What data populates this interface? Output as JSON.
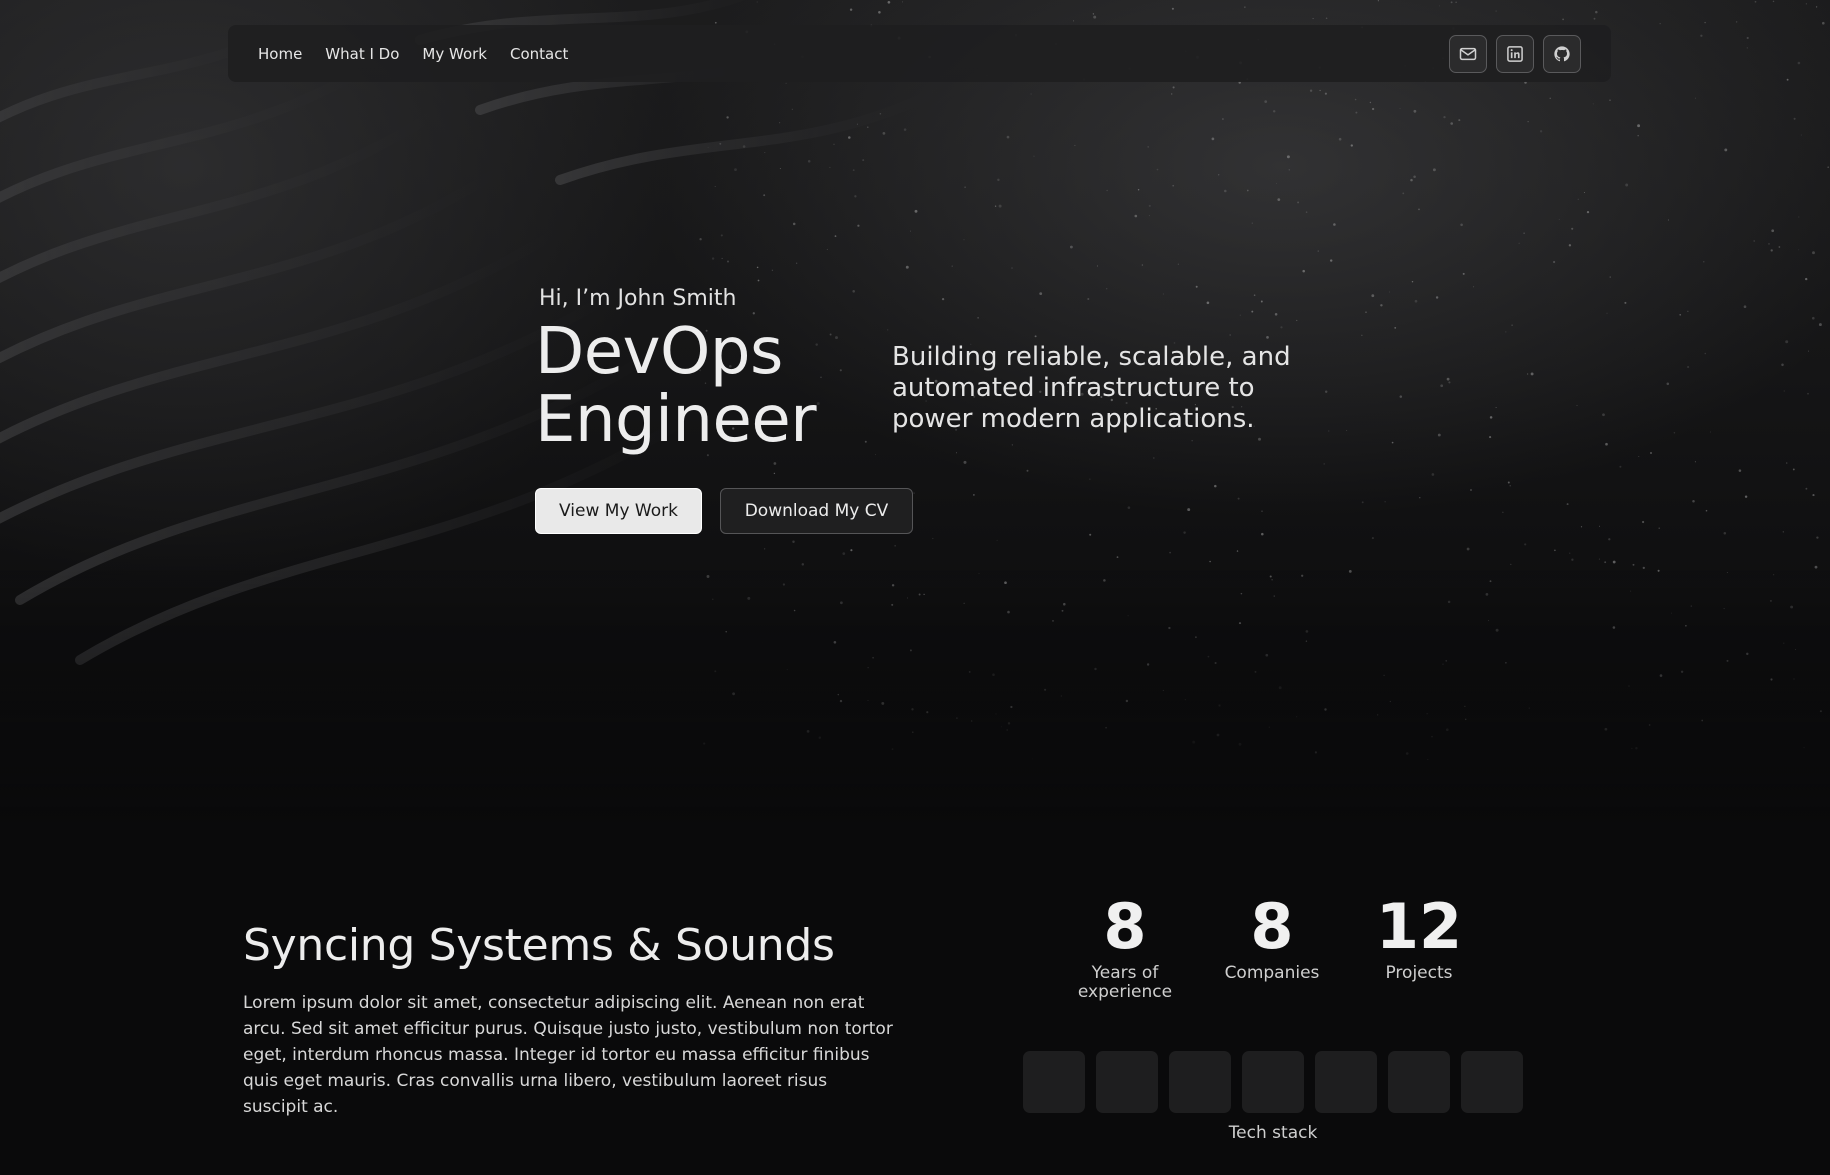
{
  "nav": {
    "links": [
      "Home",
      "What I Do",
      "My Work",
      "Contact"
    ],
    "icons": [
      "mail-icon",
      "linkedin-icon",
      "github-icon"
    ]
  },
  "hero": {
    "greeting": "Hi, I’m John Smith",
    "role_line1": "DevOps",
    "role_line2": "Engineer",
    "tagline": "Building reliable, scalable, and automated infrastructure to power modern applications.",
    "primary_button": "View My Work",
    "secondary_button": "Download My CV"
  },
  "about": {
    "title": "Syncing Systems & Sounds",
    "body": "Lorem ipsum dolor sit amet, consectetur adipiscing elit. Aenean non erat arcu. Sed sit amet efficitur purus. Quisque justo justo, vestibulum non tortor eget, interdum rhoncus massa. Integer id tortor eu massa efficitur finibus quis eget mauris. Cras convallis urna libero, vestibulum laoreet risus suscipit ac."
  },
  "stats": [
    {
      "value": "8",
      "label": "Years of experience"
    },
    {
      "value": "8",
      "label": "Companies"
    },
    {
      "value": "12",
      "label": "Projects"
    }
  ],
  "tech_stack": {
    "caption": "Tech stack"
  },
  "colors": {
    "background": "#0a0a0b",
    "nav_bg": "#1e1e1f",
    "text": "#e8e8e8",
    "primary_button_bg": "#e9e9e9"
  }
}
